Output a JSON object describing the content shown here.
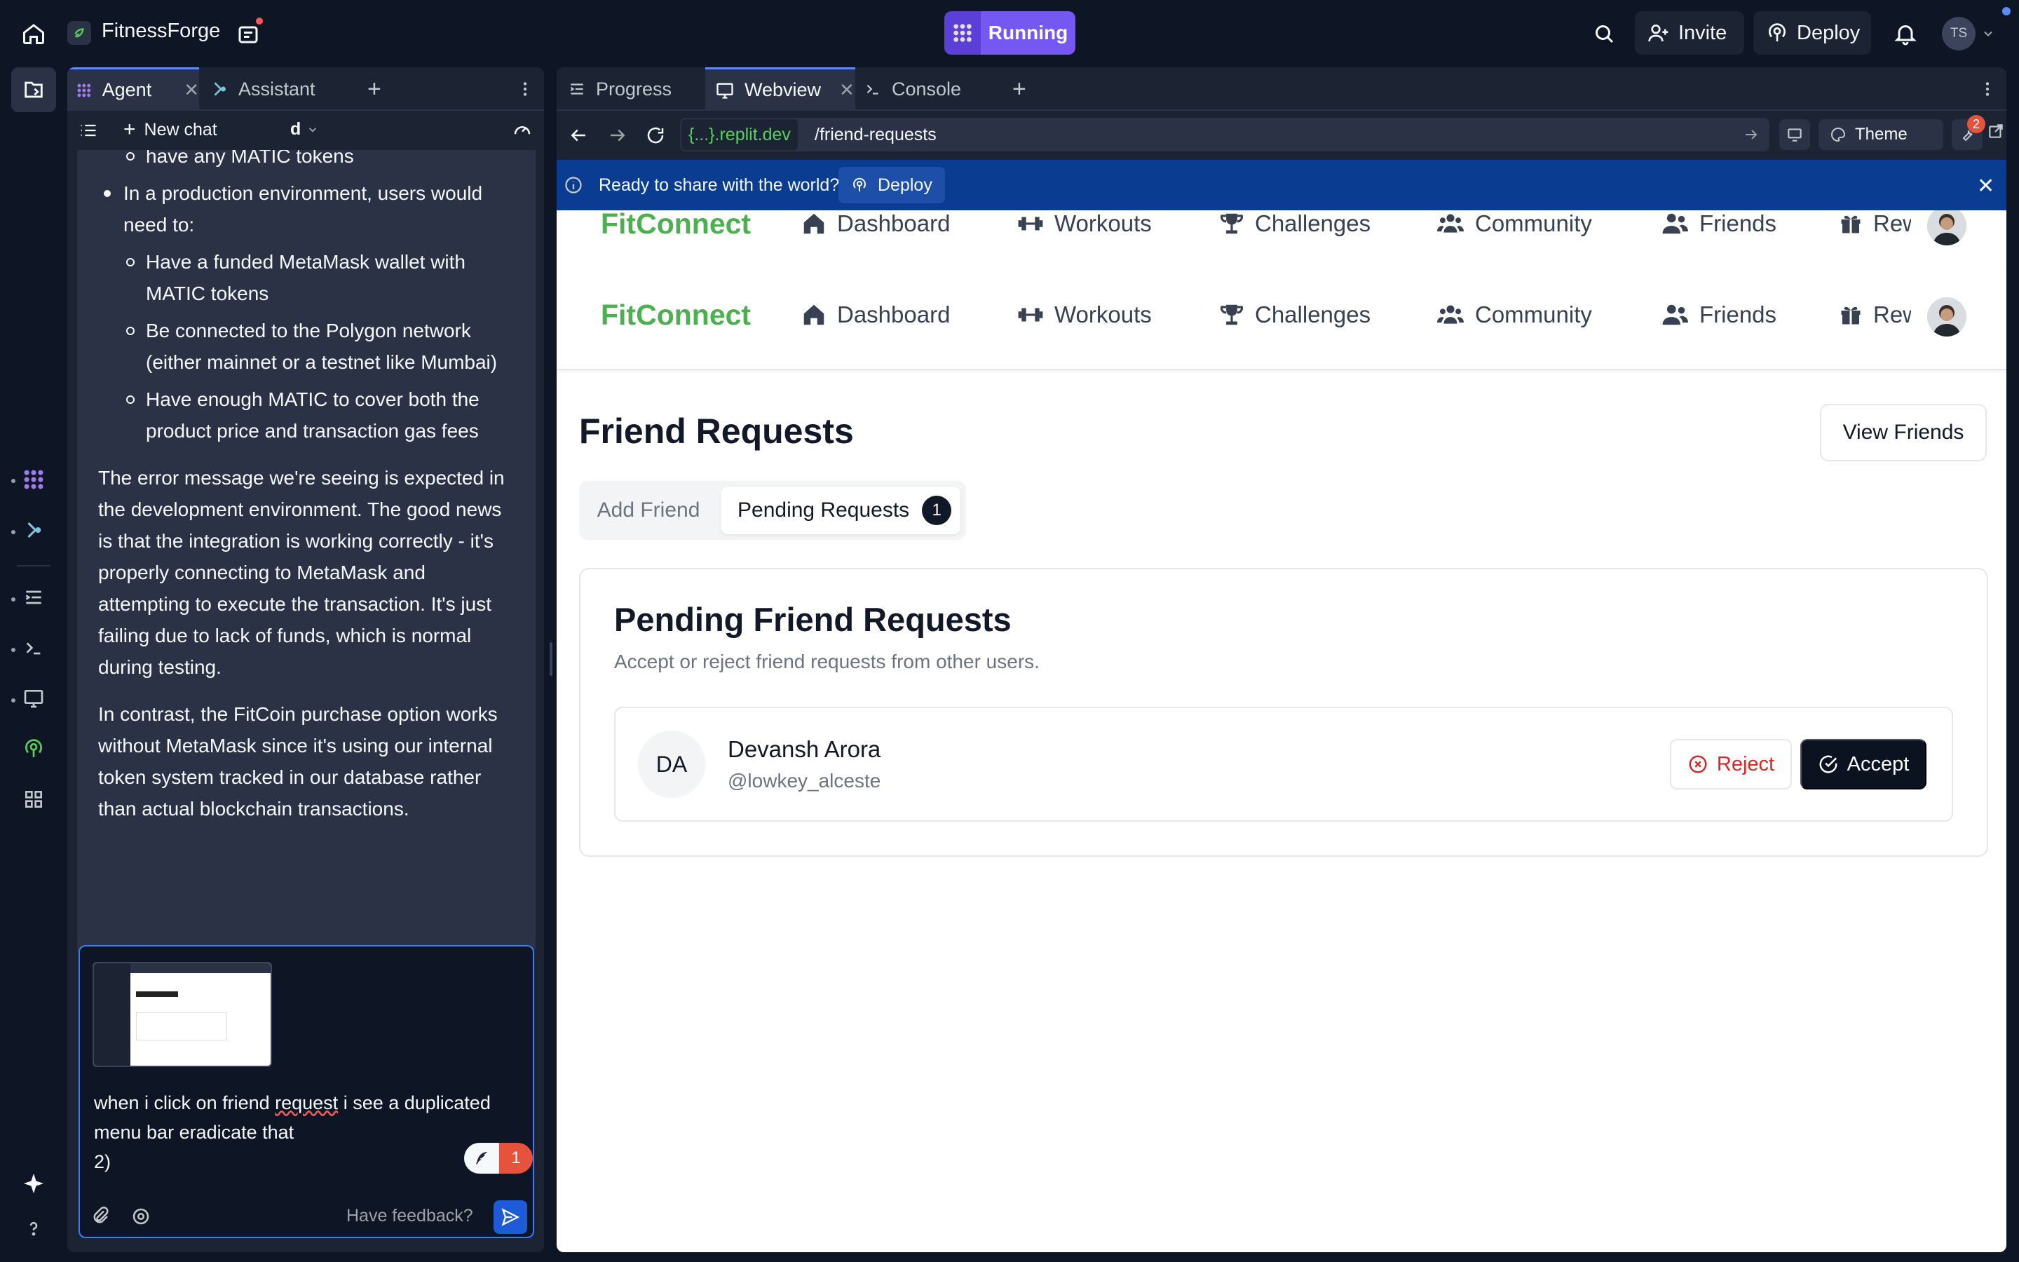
{
  "topbar": {
    "project_name": "FitnessForge",
    "run_label": "Running",
    "invite_label": "Invite",
    "deploy_label": "Deploy",
    "avatar_initials": "TS"
  },
  "agent_pane": {
    "tabs": [
      {
        "label": "Agent",
        "active": true
      },
      {
        "label": "Assistant",
        "active": false
      }
    ],
    "new_chat_label": "New chat",
    "model_label": "d",
    "messages": {
      "fragment_top": "have any MATIC tokens",
      "bullet_production": "In a production environment, users would need to:",
      "sub_bullets": [
        "Have a funded MetaMask wallet with MATIC tokens",
        "Be connected to the Polygon network (either mainnet or a testnet like Mumbai)",
        "Have enough MATIC to cover both the product price and transaction gas fees"
      ],
      "para_error": "The error message we're seeing is expected in the development environment. The good news is that the integration is working correctly - it's properly connecting to MetaMask and attempting to execute the transaction. It's just failing due to lack of funds, which is normal during testing.",
      "para_fitcoin": "In contrast, the FitCoin purchase option works without MetaMask since it's using our internal token system tracked in our database rather than actual blockchain transactions."
    },
    "input": {
      "text_before": "when i click on friend ",
      "text_misspelled": "request",
      "text_after": " i see a duplicated menu bar eradicate that",
      "text_line3": "2)",
      "badge_count": "1",
      "feedback_label": "Have feedback?"
    }
  },
  "right_pane": {
    "tabs": [
      {
        "label": "Progress",
        "active": false
      },
      {
        "label": "Webview",
        "active": true
      },
      {
        "label": "Console",
        "active": false
      }
    ],
    "url_host": "{...}.replit.dev",
    "url_path": "/friend-requests",
    "theme_label": "Theme",
    "tools_badge": "2",
    "banner_text": "Ready to share with the world?",
    "banner_deploy": "Deploy"
  },
  "webview": {
    "logo": "FitConnect",
    "nav_items": [
      "Dashboard",
      "Workouts",
      "Challenges",
      "Community",
      "Friends",
      "Rewards"
    ],
    "page_title": "Friend Requests",
    "view_friends_label": "View Friends",
    "tab_add": "Add Friend",
    "tab_pending": "Pending Requests",
    "pending_count": "1",
    "card_title": "Pending Friend Requests",
    "card_subtitle": "Accept or reject friend requests from other users.",
    "request": {
      "initials": "DA",
      "name": "Devansh Arora",
      "handle": "@lowkey_alceste",
      "reject_label": "Reject",
      "accept_label": "Accept"
    }
  },
  "colors": {
    "accent_purple": "#7558f2",
    "brand_green": "#4caf50",
    "banner_blue": "#0a3d91",
    "input_focus": "#3a7bff"
  }
}
